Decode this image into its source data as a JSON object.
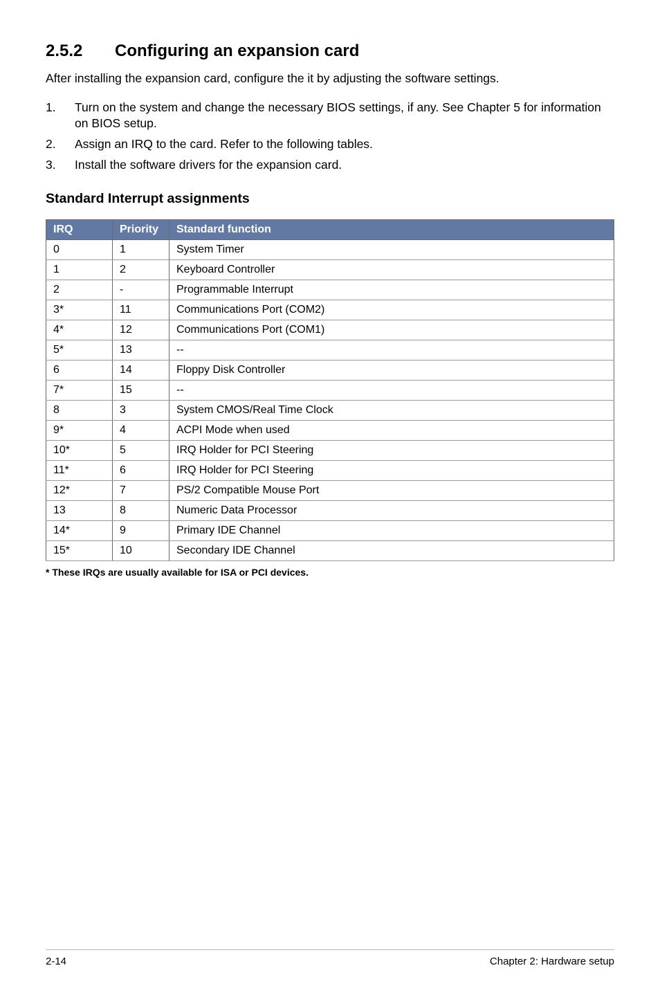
{
  "heading": {
    "number": "2.5.2",
    "title": "Configuring an expansion card"
  },
  "intro": "After installing the expansion card, configure the it by adjusting the software settings.",
  "steps": [
    {
      "num": "1.",
      "text": "Turn on the system and change the necessary BIOS settings, if any. See Chapter 5 for information on BIOS setup."
    },
    {
      "num": "2.",
      "text": "Assign an IRQ to the card. Refer to the following tables."
    },
    {
      "num": "3.",
      "text": "Install the software drivers for the expansion card."
    }
  ],
  "subheading": "Standard Interrupt assignments",
  "table": {
    "headers": {
      "irq": "IRQ",
      "priority": "Priority",
      "function": "Standard function"
    },
    "rows": [
      {
        "irq": "0",
        "priority": "1",
        "function": "System Timer"
      },
      {
        "irq": "1",
        "priority": "2",
        "function": "Keyboard Controller"
      },
      {
        "irq": "2",
        "priority": "-",
        "function": "Programmable Interrupt"
      },
      {
        "irq": "3*",
        "priority": "11",
        "function": "Communications Port (COM2)"
      },
      {
        "irq": "4*",
        "priority": "12",
        "function": "Communications Port (COM1)"
      },
      {
        "irq": "5*",
        "priority": "13",
        "function": "--"
      },
      {
        "irq": "6",
        "priority": "14",
        "function": "Floppy Disk Controller"
      },
      {
        "irq": "7*",
        "priority": "15",
        "function": "--"
      },
      {
        "irq": "8",
        "priority": "3",
        "function": "System CMOS/Real Time Clock"
      },
      {
        "irq": "9*",
        "priority": "4",
        "function": "ACPI Mode when used"
      },
      {
        "irq": "10*",
        "priority": "5",
        "function": "IRQ Holder for PCI Steering"
      },
      {
        "irq": "11*",
        "priority": "6",
        "function": "IRQ Holder for PCI Steering"
      },
      {
        "irq": "12*",
        "priority": "7",
        "function": "PS/2 Compatible Mouse Port"
      },
      {
        "irq": "13",
        "priority": "8",
        "function": "Numeric Data Processor"
      },
      {
        "irq": "14*",
        "priority": "9",
        "function": "Primary IDE Channel"
      },
      {
        "irq": "15*",
        "priority": "10",
        "function": "Secondary IDE Channel"
      }
    ]
  },
  "footnote": "* These IRQs are usually available for ISA or PCI devices.",
  "footer": {
    "left": "2-14",
    "right": "Chapter 2:  Hardware setup"
  }
}
